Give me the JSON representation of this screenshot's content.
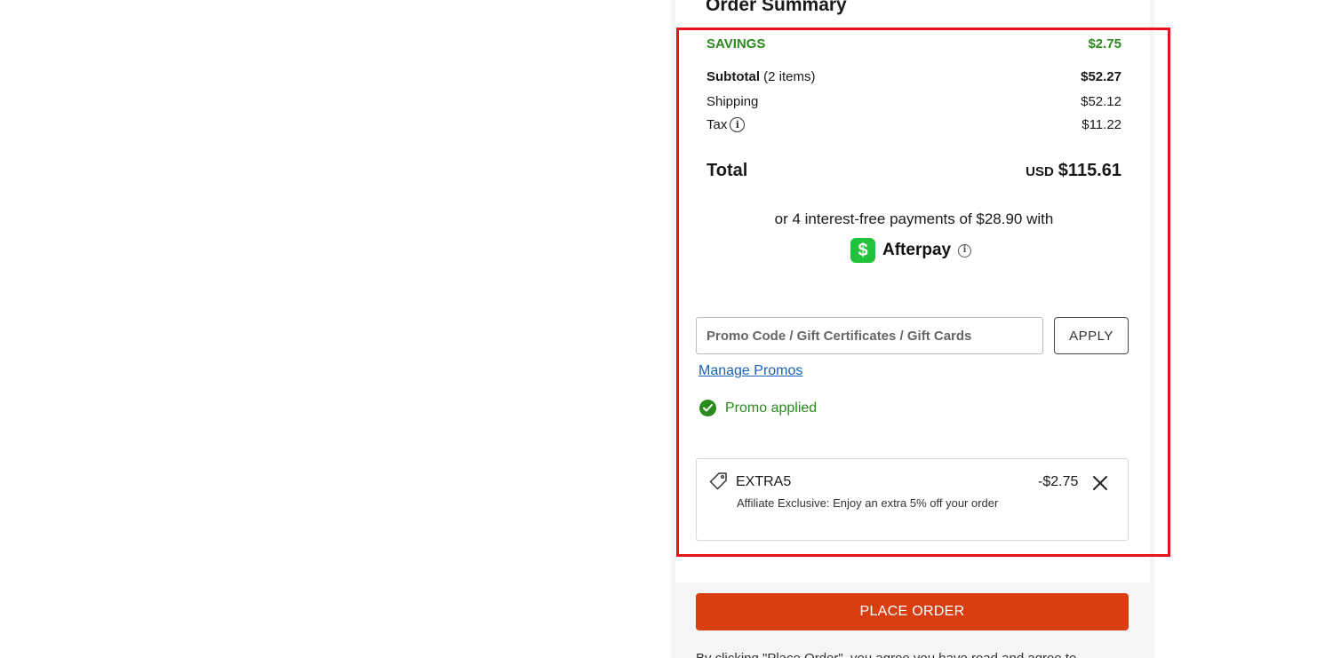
{
  "order_summary": {
    "heading": "Order Summary",
    "savings_label": "SAVINGS",
    "savings_value": "$2.75",
    "subtotal_label": "Subtotal",
    "subtotal_items": "(2 items)",
    "subtotal_value": "$52.27",
    "shipping_label": "Shipping",
    "shipping_value": "$52.12",
    "tax_label": "Tax",
    "tax_value": "$11.22",
    "total_label": "Total",
    "total_currency": "USD",
    "total_value": "$115.61"
  },
  "afterpay": {
    "text": "or 4 interest-free payments of $28.90 with",
    "logo_glyph": "$",
    "brand": "Afterpay"
  },
  "promo": {
    "input_placeholder": "Promo Code / Gift Certificates / Gift Cards",
    "input_value": "",
    "apply_label": "APPLY",
    "manage_link": "Manage Promos",
    "applied_text": "Promo applied",
    "applied_code": "EXTRA5",
    "applied_description": "Affiliate Exclusive: Enjoy an extra 5% off your order",
    "applied_amount": "-$2.75"
  },
  "place_order_label": "PLACE ORDER",
  "disclaimer": "By clicking \"Place Order\", you agree you have read and agree to",
  "colors": {
    "savings_green": "#2b8a1e",
    "link_blue": "#1a63b8",
    "place_order_orange": "#d93d12",
    "afterpay_green": "#22c33b",
    "highlight_red": "#e3141b"
  },
  "icons": {
    "tax_info": "info-icon",
    "afterpay_info": "info-icon",
    "promo_check": "check-circle-icon",
    "promo_tag": "tag-icon",
    "remove_promo": "close-icon"
  }
}
